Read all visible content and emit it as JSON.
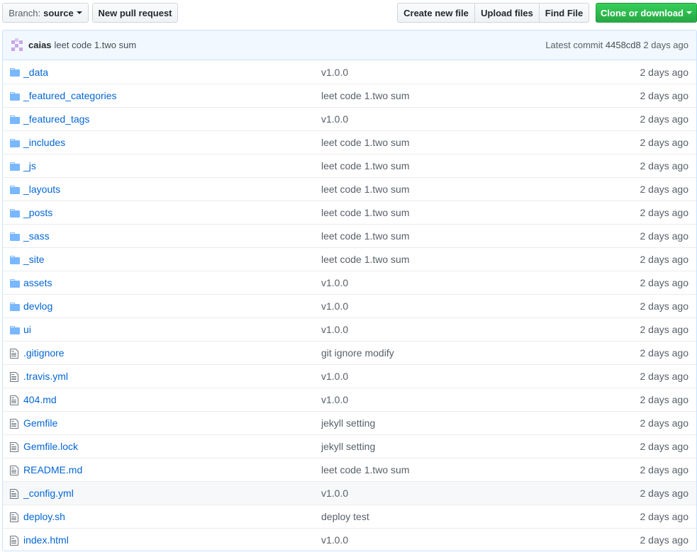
{
  "toolbar": {
    "branch_label": "Branch:",
    "branch_value": "source",
    "new_pr_label": "New pull request",
    "create_file_label": "Create new file",
    "upload_label": "Upload files",
    "find_file_label": "Find File",
    "clone_label": "Clone or download"
  },
  "commit": {
    "author": "caias",
    "message": "leet code 1.two sum",
    "latest_label": "Latest commit",
    "sha": "4458cd8",
    "age": "2 days ago"
  },
  "colors": {
    "link": "#0366d6",
    "folder": "#79b8ff",
    "clone_button": "#28a745",
    "commit_bar_bg": "#f1f8ff"
  },
  "files": [
    {
      "type": "folder",
      "icon": "folder-icon",
      "name": "_data",
      "message": "v1.0.0",
      "age": "2 days ago"
    },
    {
      "type": "folder",
      "icon": "folder-icon",
      "name": "_featured_categories",
      "message": "leet code 1.two sum",
      "age": "2 days ago"
    },
    {
      "type": "folder",
      "icon": "folder-icon",
      "name": "_featured_tags",
      "message": "v1.0.0",
      "age": "2 days ago"
    },
    {
      "type": "folder",
      "icon": "folder-icon",
      "name": "_includes",
      "message": "leet code 1.two sum",
      "age": "2 days ago"
    },
    {
      "type": "folder",
      "icon": "folder-icon",
      "name": "_js",
      "message": "leet code 1.two sum",
      "age": "2 days ago"
    },
    {
      "type": "folder",
      "icon": "folder-icon",
      "name": "_layouts",
      "message": "leet code 1.two sum",
      "age": "2 days ago"
    },
    {
      "type": "folder",
      "icon": "folder-icon",
      "name": "_posts",
      "message": "leet code 1.two sum",
      "age": "2 days ago"
    },
    {
      "type": "folder",
      "icon": "folder-icon",
      "name": "_sass",
      "message": "leet code 1.two sum",
      "age": "2 days ago"
    },
    {
      "type": "folder",
      "icon": "folder-icon",
      "name": "_site",
      "message": "leet code 1.two sum",
      "age": "2 days ago"
    },
    {
      "type": "folder",
      "icon": "folder-icon",
      "name": "assets",
      "message": "v1.0.0",
      "age": "2 days ago"
    },
    {
      "type": "folder",
      "icon": "folder-icon",
      "name": "devlog",
      "message": "v1.0.0",
      "age": "2 days ago"
    },
    {
      "type": "folder",
      "icon": "folder-icon",
      "name": "ui",
      "message": "v1.0.0",
      "age": "2 days ago"
    },
    {
      "type": "file",
      "icon": "file-icon",
      "name": ".gitignore",
      "message": "git ignore modify",
      "age": "2 days ago"
    },
    {
      "type": "file",
      "icon": "file-icon",
      "name": ".travis.yml",
      "message": "v1.0.0",
      "age": "2 days ago"
    },
    {
      "type": "file",
      "icon": "file-icon",
      "name": "404.md",
      "message": "v1.0.0",
      "age": "2 days ago"
    },
    {
      "type": "file",
      "icon": "file-icon",
      "name": "Gemfile",
      "message": "jekyll setting",
      "age": "2 days ago"
    },
    {
      "type": "file",
      "icon": "file-icon",
      "name": "Gemfile.lock",
      "message": "jekyll setting",
      "age": "2 days ago"
    },
    {
      "type": "file",
      "icon": "file-icon",
      "name": "README.md",
      "message": "leet code 1.two sum",
      "age": "2 days ago"
    },
    {
      "type": "file",
      "icon": "file-icon",
      "name": "_config.yml",
      "message": "v1.0.0",
      "age": "2 days ago",
      "highlighted": true
    },
    {
      "type": "file",
      "icon": "file-icon",
      "name": "deploy.sh",
      "message": "deploy test",
      "age": "2 days ago"
    },
    {
      "type": "file",
      "icon": "file-icon",
      "name": "index.html",
      "message": "v1.0.0",
      "age": "2 days ago"
    }
  ]
}
